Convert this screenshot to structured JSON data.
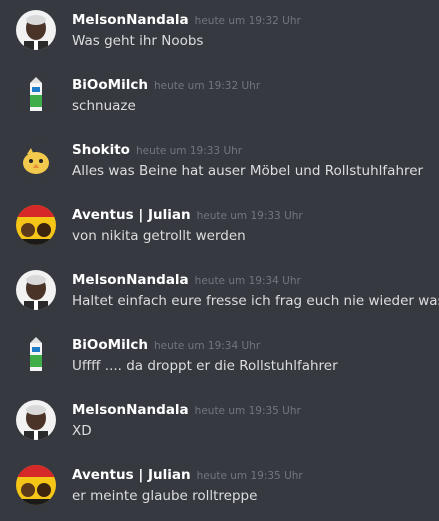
{
  "messages": [
    {
      "author": "MelsonNandala",
      "timestamp": "heute um 19:32 Uhr",
      "text": "Was geht ihr Noobs",
      "avatar_icon": "portrait-avatar-icon"
    },
    {
      "author": "BiOoMilch",
      "timestamp": "heute um 19:32 Uhr",
      "text": "schnuaze",
      "avatar_icon": "milk-carton-avatar-icon"
    },
    {
      "author": "Shokito",
      "timestamp": "heute um 19:33 Uhr",
      "text": "Alles was Beine hat auser Möbel und Rollstuhlfahrer",
      "avatar_icon": "yellow-bird-avatar-icon"
    },
    {
      "author": "Aventus | Julian",
      "timestamp": "heute um 19:33 Uhr",
      "text": "von nikita getrollt werden",
      "avatar_icon": "poster-avatar-icon"
    },
    {
      "author": "MelsonNandala",
      "timestamp": "heute um 19:34 Uhr",
      "text": "Haltet einfach eure fresse ich frag euch nie wieder was",
      "avatar_icon": "portrait-avatar-icon"
    },
    {
      "author": "BiOoMilch",
      "timestamp": "heute um 19:34 Uhr",
      "text": "Uffff .... da droppt er die Rollstuhlfahrer",
      "avatar_icon": "milk-carton-avatar-icon"
    },
    {
      "author": "MelsonNandala",
      "timestamp": "heute um 19:35 Uhr",
      "text": "XD",
      "avatar_icon": "portrait-avatar-icon"
    },
    {
      "author": "Aventus | Julian",
      "timestamp": "heute um 19:35 Uhr",
      "text": "er meinte glaube rolltreppe",
      "avatar_icon": "poster-avatar-icon"
    }
  ],
  "colors": {
    "background": "#36393f",
    "username": "#ffffff",
    "timestamp": "#72767d",
    "text": "#dcddde"
  }
}
